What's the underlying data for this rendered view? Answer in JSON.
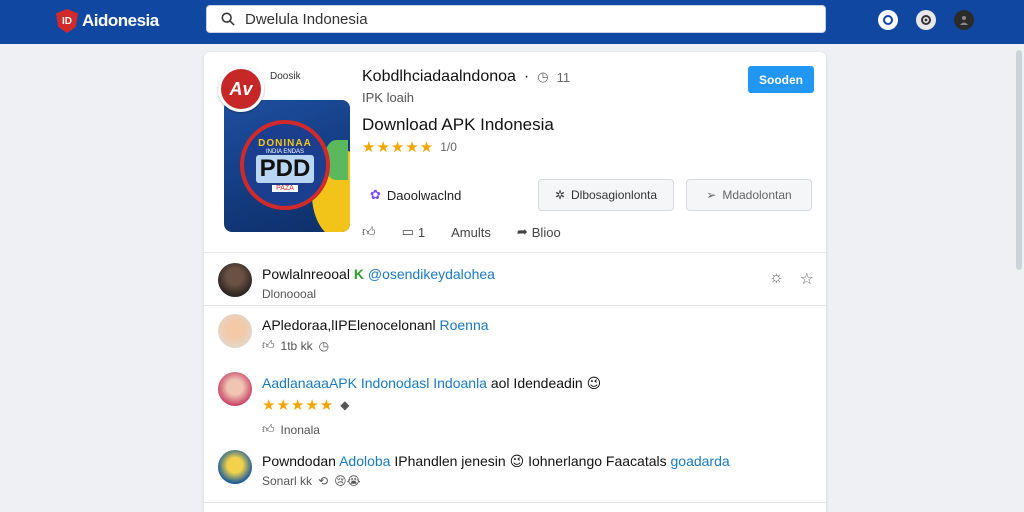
{
  "header": {
    "logo_text": "Aidonesia",
    "search_value": "Dwelula Indonesia",
    "icons": [
      "refresh-icon",
      "settings-icon",
      "account-icon"
    ]
  },
  "app": {
    "badge": "Av",
    "icon_label": "Doosik",
    "emblem_top": "DONINAA",
    "emblem_mid": "INDIA ENDAS",
    "emblem_big": "PDD",
    "emblem_bot": "PAZA",
    "title": "Kobdlhciadaalndonoa",
    "title_extra": "·",
    "version": "11",
    "subtitle": "IPK loaih",
    "heading": "Download APK Indonesia",
    "stars": "★★★★★",
    "rating": "1/0",
    "primary_button": "Sooden",
    "download_link": "Daoolwaclnd",
    "button_one": "Dlbosagionlonta",
    "button_two": "Mdadolontan",
    "social_like": "",
    "social_comment": "1",
    "social_amults": "Amults",
    "social_share": "Blioo"
  },
  "comments": [
    {
      "name": "Powlalnreooal",
      "tag": "K",
      "handle": "@osendikeydalohea",
      "sub": "Dlonoooal"
    },
    {
      "text": "APledoraa,lIPElenocelonanl",
      "link": "Roenna",
      "meta": "1tb kk"
    },
    {
      "link_text": "AadlanaaaAPK Indonodasl Indoanla",
      "text": "aol Idendeadin",
      "emoji": "😉",
      "stars": "★★★★★",
      "meta": "Inonala"
    },
    {
      "name": "Powndodan",
      "tag": "Adoloba",
      "text": "IPhandlen jenesin",
      "emoji": "😉",
      "text2": "Iohnerlango Faacatals",
      "link": "goadarda",
      "meta": "Sonarl kk",
      "emoji2": "😢😭"
    }
  ],
  "colors": {
    "header_bg": "#0f47a1",
    "primary": "#2196f3",
    "star": "#f0a500",
    "link": "#1a7ac4"
  }
}
